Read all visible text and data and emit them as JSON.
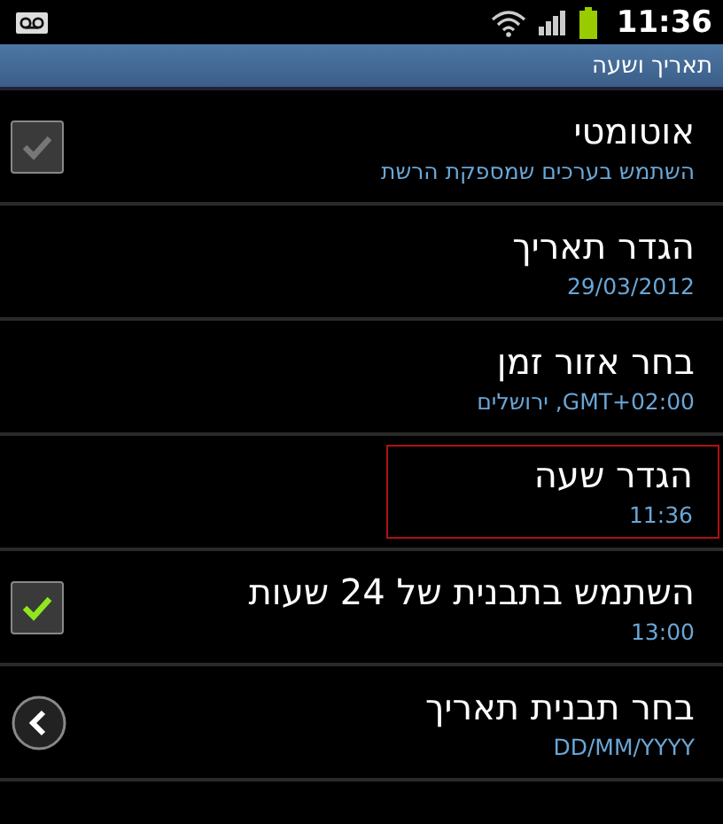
{
  "status_bar": {
    "time": "11:36"
  },
  "title": "תאריך ושעה",
  "items": [
    {
      "kind": "checkbox",
      "title": "אוטומטי",
      "summary": "השתמש בערכים שמספקת הרשת",
      "checked": true,
      "disabled": true,
      "highlighted": false
    },
    {
      "kind": "plain",
      "title": "הגדר תאריך",
      "summary": "29/03/2012",
      "highlighted": false
    },
    {
      "kind": "plain",
      "title": "בחר אזור זמן",
      "summary": "ירושלים ,GMT+02:00",
      "highlighted": false
    },
    {
      "kind": "plain",
      "title": "הגדר שעה",
      "summary": "11:36",
      "highlighted": true
    },
    {
      "kind": "checkbox",
      "title": "השתמש בתבנית של 24 שעות",
      "summary": "13:00",
      "checked": true,
      "disabled": false,
      "highlighted": false
    },
    {
      "kind": "chevron",
      "title": "בחר תבנית תאריך",
      "summary": "DD/MM/YYYY",
      "highlighted": false
    }
  ]
}
